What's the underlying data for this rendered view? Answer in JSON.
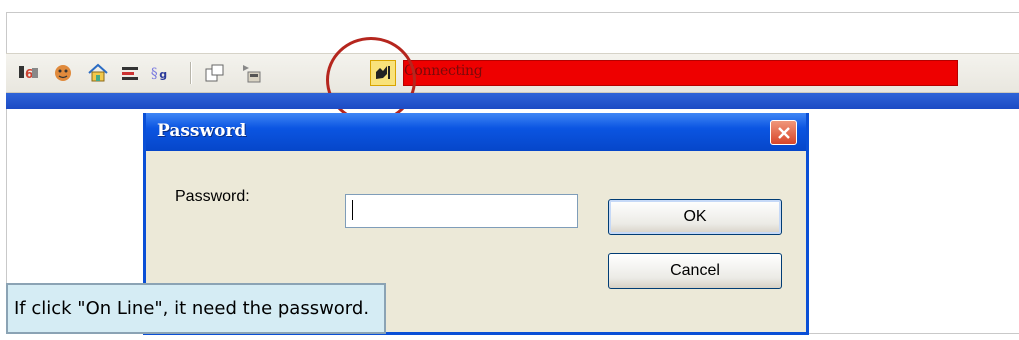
{
  "toolbar": {
    "icons": [
      "io-tags-icon",
      "face-icon",
      "home-icon",
      "monitor-icon",
      "script-icon",
      "layout-icon",
      "download-icon",
      "online-icon"
    ],
    "status_text": "Connecting",
    "status_color": "#ee0000"
  },
  "dialog": {
    "title": "Password",
    "password_label": "Password:",
    "password_value": "",
    "ok_label": "OK",
    "cancel_label": "Cancel"
  },
  "callout": {
    "text": "If click \"On Line\", it need the password."
  },
  "colors": {
    "title_bar": "#0b55e2",
    "close_button": "#d8452a",
    "highlight_circle": "#b5261e",
    "callout_bg": "#d5ecf4"
  }
}
